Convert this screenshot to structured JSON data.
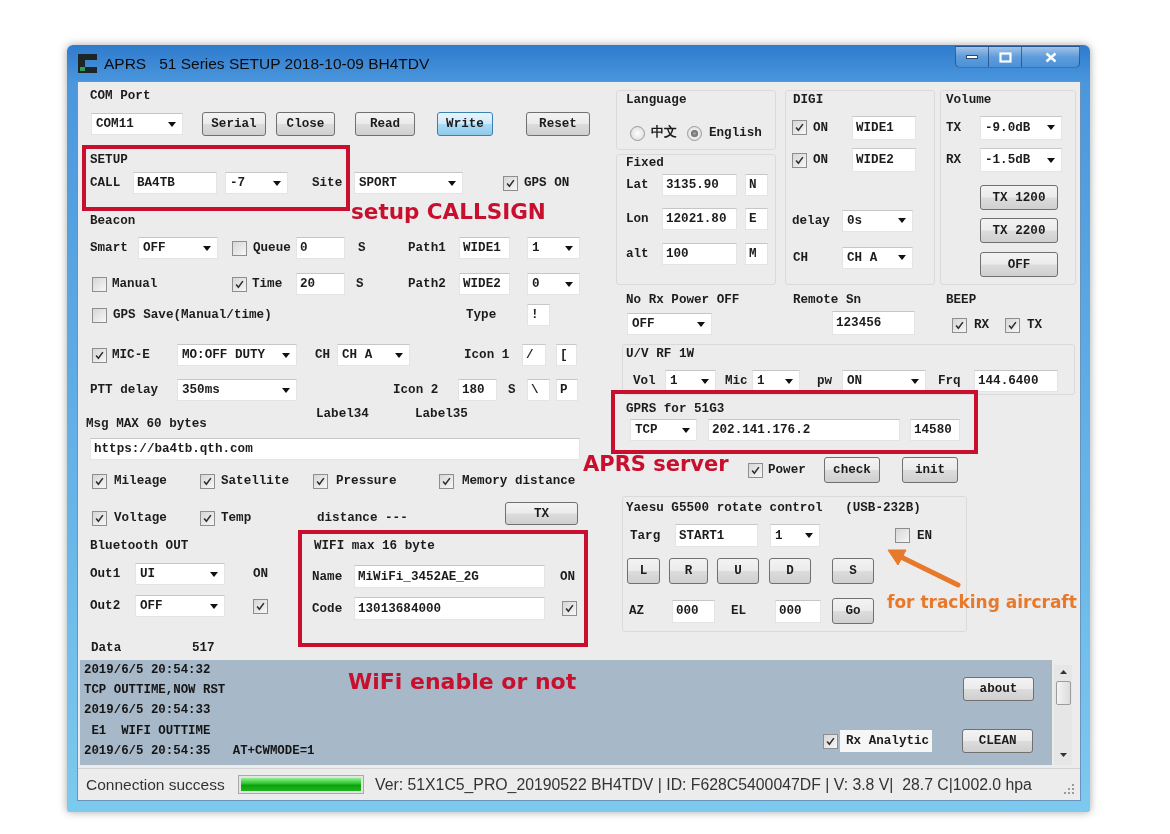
{
  "window": {
    "title": "APRS   51 Series SETUP 2018-10-09 BH4TDV"
  },
  "com_port": {
    "label": "COM Port",
    "port": "COM11",
    "buttons": [
      {
        "label": "Serial",
        "focused": false
      },
      {
        "label": "Close",
        "focused": false
      },
      {
        "label": "Read",
        "focused": false
      },
      {
        "label": "Write",
        "focused": true
      },
      {
        "label": "Reset",
        "focused": false
      }
    ]
  },
  "setup": {
    "label": "SETUP",
    "call_label": "CALL",
    "call": "BA4TB",
    "ssid": "-7",
    "site_label": "Site",
    "site": "SPORT",
    "gps_on": {
      "label": "GPS ON",
      "checked": true
    }
  },
  "beacon": {
    "label": "Beacon",
    "smart_label": "Smart",
    "smart": "OFF",
    "queue": {
      "label": "Queue",
      "checked": false
    },
    "queue_value": "0",
    "queue_unit": "S",
    "path1_label": "Path1",
    "path1": "WIDE1",
    "path1_hops": "1",
    "manual": {
      "label": "Manual",
      "checked": false
    },
    "time": {
      "label": "Time",
      "checked": true
    },
    "time_value": "20",
    "time_unit": "S",
    "path2_label": "Path2",
    "path2": "WIDE2",
    "path2_hops": "0",
    "gps_save": {
      "label": "GPS Save(Manual/time)",
      "checked": false
    },
    "type_label": "Type",
    "type": "!",
    "mic_e": {
      "label": "MIC-E",
      "checked": true
    },
    "mic_e_mode": "MO:OFF DUTY",
    "ch_label": "CH",
    "ch": "CH A",
    "icon1_label": "Icon 1",
    "icon1": [
      "/",
      "["
    ],
    "ptt_label": "PTT delay",
    "ptt_delay": "350ms",
    "icon2_label": "Icon 2",
    "icon2_interval": "180",
    "icon2_unit": "S",
    "icon2": [
      "\\",
      "P"
    ],
    "label_34": "Label34",
    "label_35": "Label35"
  },
  "message": {
    "label": "Msg MAX 60 bytes",
    "value": "https://ba4tb.qth.com",
    "options": [
      {
        "label": "Mileage",
        "checked": true
      },
      {
        "label": "Satellite",
        "checked": true
      },
      {
        "label": "Pressure",
        "checked": true
      },
      {
        "label": "Memory distance",
        "checked": true
      },
      {
        "label": "Voltage",
        "checked": true
      },
      {
        "label": "Temp",
        "checked": true
      }
    ],
    "distance": "distance ---",
    "tx_button": "TX"
  },
  "bluetooth": {
    "label": "Bluetooth OUT",
    "out1_label": "Out1",
    "out1": "UI",
    "out2_label": "Out2",
    "out2": "OFF",
    "on": {
      "label": "ON",
      "checked": true
    }
  },
  "wifi": {
    "label": "WIFI max 16 byte",
    "name_label": "Name",
    "name": "MiWiFi_3452AE_2G",
    "code_label": "Code",
    "code": "13013684000",
    "on": {
      "label": "ON",
      "checked": true
    }
  },
  "data": {
    "label": "Data",
    "value": "517"
  },
  "language": {
    "label": "Language",
    "options": [
      {
        "label": "中文",
        "selected": false
      },
      {
        "label": "English",
        "selected": true
      }
    ]
  },
  "fixed": {
    "label": "Fixed",
    "rows": [
      {
        "label": "Lat",
        "value": "3135.90",
        "suffix": "N"
      },
      {
        "label": "Lon",
        "value": "12021.80",
        "suffix": "E"
      },
      {
        "label": "alt",
        "value": "100",
        "suffix": "M"
      }
    ]
  },
  "digi": {
    "label": "DIGI",
    "paths": [
      {
        "label": "ON",
        "checked": true,
        "value": "WIDE1"
      },
      {
        "label": "ON",
        "checked": true,
        "value": "WIDE2"
      }
    ],
    "delay_label": "delay",
    "delay": "0s",
    "ch_label": "CH",
    "ch": "CH A"
  },
  "volume": {
    "label": "Volume",
    "levels": [
      {
        "label": "TX",
        "value": "-9.0dB"
      },
      {
        "label": "RX",
        "value": "-1.5dB"
      }
    ],
    "buttons": [
      "TX 1200",
      "TX 2200",
      "OFF"
    ]
  },
  "no_rx_power": {
    "label": "No Rx Power OFF",
    "value": "OFF"
  },
  "remote_sn": {
    "label": "Remote Sn",
    "value": "123456"
  },
  "beep": {
    "label": "BEEP",
    "options": [
      {
        "label": "RX",
        "checked": true
      },
      {
        "label": "TX",
        "checked": true
      }
    ]
  },
  "rf": {
    "label": "U/V RF 1W",
    "vol_label": "Vol",
    "vol": "1",
    "mic_label": "Mic",
    "mic": "1",
    "pw_label": "pw",
    "pw": "ON",
    "frq_label": "Frq",
    "frq": "144.6400"
  },
  "gprs": {
    "label": "GPRS for 51G3",
    "protocol": "TCP",
    "server": "202.141.176.2",
    "port": "14580",
    "power": {
      "label": "Power",
      "checked": true
    },
    "buttons": [
      "check",
      "init"
    ]
  },
  "rotator": {
    "label": "Yaesu G5500 rotate control   (USB-232B)",
    "targ_label": "Targ",
    "targ": "START1",
    "targ_index": "1",
    "en": {
      "label": "EN",
      "checked": false
    },
    "buttons": [
      "L",
      "R",
      "U",
      "D",
      "S"
    ],
    "az_label": "AZ",
    "az": "000",
    "el_label": "EL",
    "el": "000",
    "go_button": "Go"
  },
  "log": {
    "lines": [
      "2019/6/5 20:54:32",
      "TCP OUTTIME,NOW RST",
      "2019/6/5 20:54:33",
      " E1  WIFI OUTTIME",
      "2019/6/5 20:54:35   AT+CWMODE=1"
    ],
    "about_button": "about",
    "rx_analytic": {
      "label": "Rx Analytic",
      "checked": true
    },
    "clean_button": "CLEAN"
  },
  "status_bar": {
    "connection": "Connection success",
    "progress": {
      "level": 1
    },
    "info": "Ver: 51X1C5_PRO_20190522 BH4TDV | ID: F628C5400047DF | V: 3.8 V|  28.7 C|1002.0 hpa"
  },
  "annotations": [
    {
      "kind": "frame",
      "text": "setup CALLSIGN",
      "color": "#c8102e"
    },
    {
      "kind": "frame",
      "text": "APRS server",
      "color": "#c8102e"
    },
    {
      "kind": "frame",
      "text": "WiFi enable or not",
      "color": "#c8102e"
    },
    {
      "kind": "arrow",
      "text": "for tracking aircraft",
      "color": "#e8782a"
    }
  ]
}
